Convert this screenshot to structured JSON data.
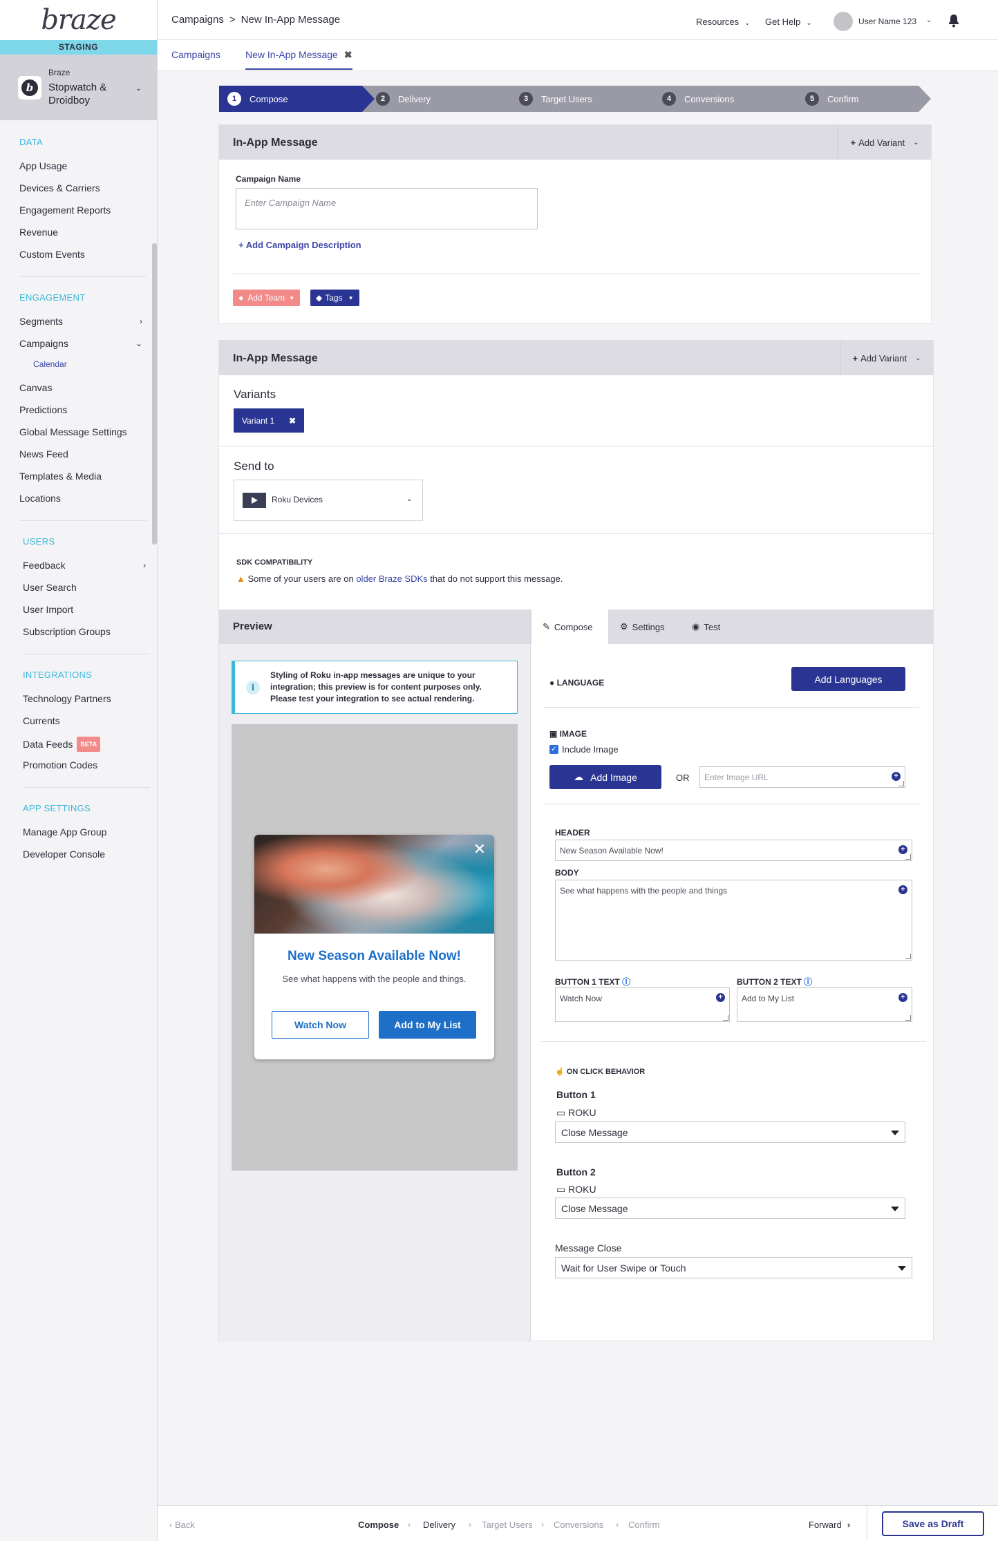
{
  "sidebar": {
    "logo": "braze",
    "env_badge": "STAGING",
    "app": {
      "company": "Braze",
      "name": "Stopwatch & Droidboy"
    },
    "sections": {
      "data": {
        "title": "DATA",
        "items": [
          "App Usage",
          "Devices & Carriers",
          "Engagement Reports",
          "Revenue",
          "Custom Events"
        ]
      },
      "engagement": {
        "title": "ENGAGEMENT",
        "items": [
          "Segments",
          "Campaigns",
          "Calendar",
          "Canvas",
          "Predictions",
          "Global Message Settings",
          "News Feed",
          "Templates & Media",
          "Locations"
        ]
      },
      "users": {
        "title": "USERS",
        "items": [
          "Feedback",
          "User Search",
          "User Import",
          "Subscription Groups"
        ]
      },
      "integrations": {
        "title": "INTEGRATIONS",
        "items": [
          "Technology Partners",
          "Currents",
          "Data Feeds",
          "Promotion Codes"
        ],
        "beta_label": "BETA"
      },
      "app_settings": {
        "title": "APP SETTINGS",
        "items": [
          "Manage App Group",
          "Developer Console"
        ]
      }
    }
  },
  "topbar": {
    "breadcrumb": [
      "Campaigns",
      "New In-App Message"
    ],
    "breadcrumb_sep": ">",
    "resources": "Resources",
    "get_help": "Get Help",
    "user_name": "User Name 123"
  },
  "page_tabs": {
    "campaigns": "Campaigns",
    "active": "New In-App Message",
    "close": "✖"
  },
  "steps": [
    {
      "num": "1",
      "label": "Compose"
    },
    {
      "num": "2",
      "label": "Delivery"
    },
    {
      "num": "3",
      "label": "Target Users"
    },
    {
      "num": "4",
      "label": "Conversions"
    },
    {
      "num": "5",
      "label": "Confirm"
    }
  ],
  "panel1": {
    "title": "In-App Message",
    "add_variant": "Add Variant",
    "campaign_name_label": "Campaign Name",
    "campaign_name_placeholder": "Enter Campaign Name",
    "add_description": "Add Campaign Description",
    "add_team": "Add Team",
    "tags": "Tags"
  },
  "panel2": {
    "title": "In-App Message",
    "add_variant": "Add Variant",
    "variants_label": "Variants",
    "variant_chip": "Variant 1",
    "send_to_label": "Send to",
    "send_to_value": "Roku Devices",
    "sdk_title": "SDK COMPATIBILITY",
    "sdk_text_pre": "Some of your users are on",
    "sdk_link": "older Braze SDKs",
    "sdk_text_post": "that do not support this message."
  },
  "preview": {
    "title": "Preview",
    "info": "Styling of Roku in-app messages are unique to your integration; this preview is for content purposes only. Please test your integration to see actual rendering.",
    "card": {
      "header": "New Season Available Now!",
      "body": "See what happens with the people and things.",
      "button1": "Watch Now",
      "button2": "Add to My List"
    }
  },
  "compose": {
    "tabs": [
      "Compose",
      "Settings",
      "Test"
    ],
    "language_label": "LANGUAGE",
    "add_languages": "Add Languages",
    "image_label": "IMAGE",
    "include_image": "Include Image",
    "add_image": "Add Image",
    "or": "OR",
    "image_url_placeholder": "Enter Image URL",
    "header_label": "HEADER",
    "header_value": "New Season Available Now!",
    "body_label": "BODY",
    "body_value": "See what happens with the people and things",
    "button1_label": "BUTTON 1 TEXT",
    "button1_value": "Watch Now",
    "button2_label": "BUTTON 2 TEXT",
    "button2_value": "Add to My List",
    "on_click_label": "ON CLICK BEHAVIOR",
    "b1_title": "Button 1",
    "b1_platform": "ROKU",
    "b1_action": "Close Message",
    "b2_title": "Button 2",
    "b2_platform": "ROKU",
    "b2_action": "Close Message",
    "message_close_label": "Message Close",
    "message_close_value": "Wait for User Swipe or Touch"
  },
  "footer": {
    "back": "Back",
    "steps": [
      "Compose",
      "Delivery",
      "Target Users",
      "Conversions",
      "Confirm"
    ],
    "forward": "Forward",
    "save_draft": "Save as Draft"
  },
  "colors": {
    "primary": "#2a3593",
    "accent": "#3cb6d9",
    "link": "#3b46a8",
    "preview_blue": "#1e6fc8",
    "team_pill": "#f28a8a"
  }
}
